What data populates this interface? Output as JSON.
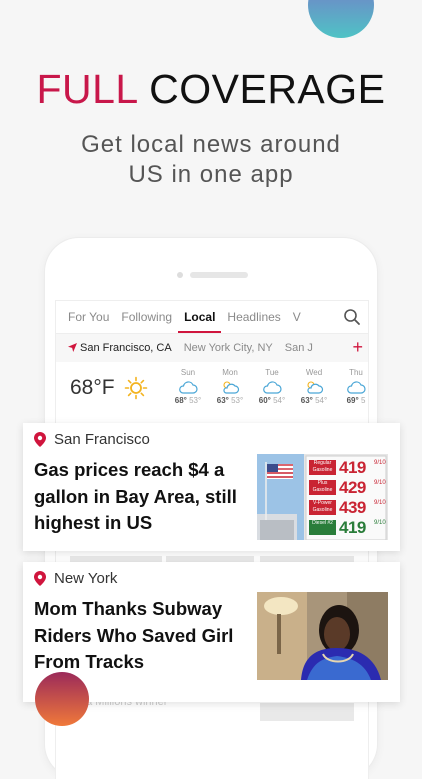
{
  "headline": {
    "accent": "FULL",
    "rest": "COVERAGE"
  },
  "subtitle": {
    "line1": "Get local news around",
    "line2": "US in one app"
  },
  "tabs": [
    "For You",
    "Following",
    "Local",
    "Headlines",
    "V"
  ],
  "cities": [
    "San Francisco, CA",
    "New York City, NY",
    "San J"
  ],
  "weather": {
    "current_temp": "68°F",
    "days": [
      {
        "name": "Sun",
        "high": "68°",
        "low": "53°"
      },
      {
        "name": "Mon",
        "high": "63°",
        "low": "53°"
      },
      {
        "name": "Tue",
        "high": "60°",
        "low": "54°"
      },
      {
        "name": "Wed",
        "high": "63°",
        "low": "54°"
      },
      {
        "name": "Thu",
        "high": "69°",
        "low": "5"
      }
    ]
  },
  "cards": [
    {
      "location": "San Francisco",
      "title": "Gas prices reach $4 a gallon in Bay Area, still highest in US"
    },
    {
      "location": "New York",
      "title": "Mom Thanks Subway Riders Who Saved Girl From Tracks"
    }
  ],
  "gas_sign": {
    "rows": [
      {
        "label": "Regular Gasoline",
        "price": "419"
      },
      {
        "label": "Plus Gasoline",
        "price": "429"
      },
      {
        "label": "V-Power Gasoline",
        "price": "439"
      },
      {
        "label": "Diesel #2",
        "price": "419"
      }
    ],
    "fraction": "9/10"
  },
  "behind_text": "ga Millions winner"
}
